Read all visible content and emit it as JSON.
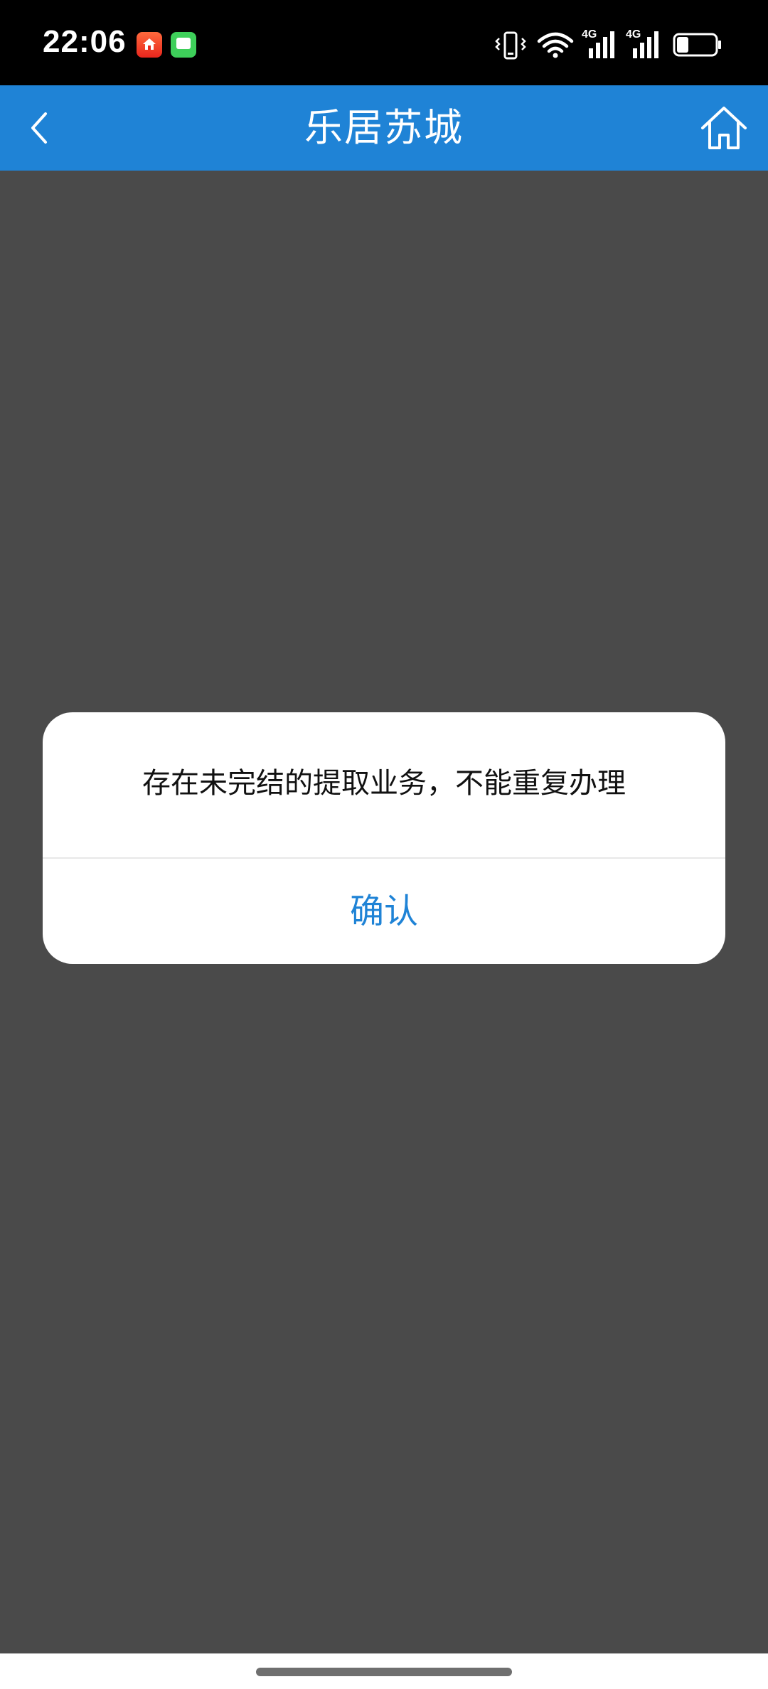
{
  "status_bar": {
    "time": "22:06",
    "notification_icons": [
      "leju-app-icon",
      "message-app-icon"
    ],
    "right_icons": [
      "vibrate-icon",
      "wifi-icon",
      "signal-4g-icon",
      "signal-4g-icon",
      "battery-icon"
    ],
    "network_label_1": "4G",
    "network_label_2": "4G",
    "battery_level": 0.3
  },
  "header": {
    "title": "乐居苏城",
    "back_icon": "chevron-left-icon",
    "home_icon": "home-icon",
    "background_color": "#1f83d6"
  },
  "dialog": {
    "message": "存在未完结的提取业务，不能重复办理",
    "confirm_label": "确认",
    "confirm_color": "#1f83d6"
  },
  "colors": {
    "overlay": "#4a4a4a",
    "status_bar": "#000000"
  }
}
